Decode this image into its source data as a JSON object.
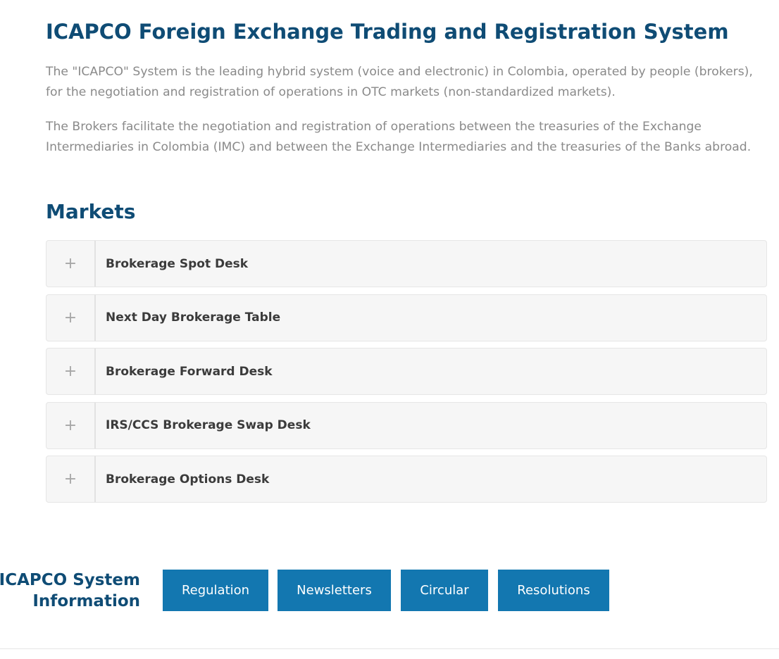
{
  "header": {
    "title": "ICAPCO Foreign Exchange Trading and Registration System"
  },
  "intro": {
    "paragraph_1": "The \"ICAPCO\" System is the leading hybrid system (voice and electronic) in Colombia, operated by people (brokers), for the negotiation and registration of operations in OTC markets (non-standardized markets).",
    "paragraph_2": "The Brokers facilitate the negotiation and registration of operations between the treasuries of the Exchange Intermediaries in Colombia (IMC) and between the Exchange Intermediaries and the treasuries of the Banks abroad."
  },
  "markets": {
    "title": "Markets",
    "toggle_icon": "+",
    "items": [
      {
        "label": "Brokerage Spot Desk"
      },
      {
        "label": "Next Day Brokerage Table"
      },
      {
        "label": "Brokerage Forward Desk"
      },
      {
        "label": "IRS/CCS Brokerage Swap Desk"
      },
      {
        "label": "Brokerage Options Desk"
      }
    ]
  },
  "system_info": {
    "title_line_1": "ICAPCO System",
    "title_line_2": "Information",
    "buttons": {
      "regulation": "Regulation",
      "newsletters": "Newsletters",
      "circular": "Circular",
      "resolutions": "Resolutions"
    }
  },
  "colors": {
    "heading": "#0f4c75",
    "body_text": "#8a8a8a",
    "button_bg": "#1377b0",
    "accordion_bg": "#f6f6f6"
  }
}
